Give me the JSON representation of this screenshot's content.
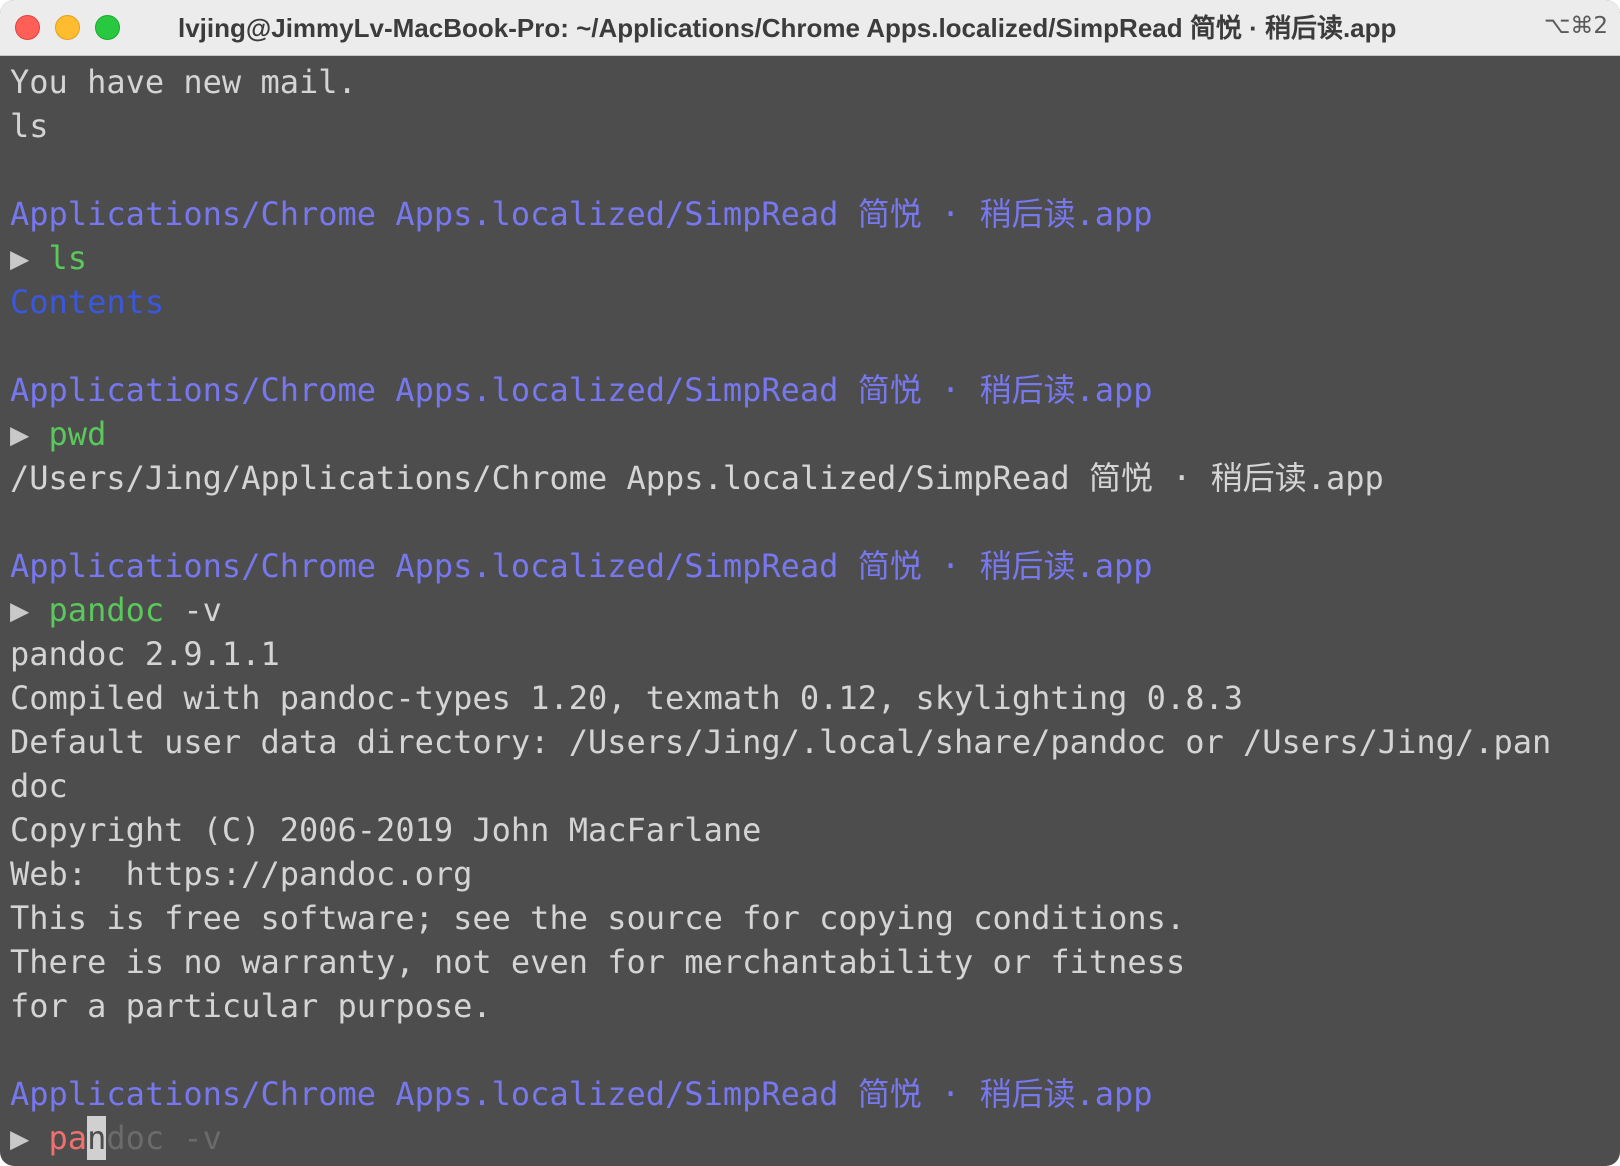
{
  "window": {
    "title": "lvjing@JimmyLv-MacBook-Pro: ~/Applications/Chrome Apps.localized/SimpRead 简悦 · 稍后读.app",
    "shortcut": "⌥⌘2"
  },
  "terminal": {
    "mail_notice": "You have new mail.",
    "typed_ls": "ls",
    "prompt_path": "Applications/Chrome Apps.localized/SimpRead 简悦 · 稍后读.app",
    "prompt_symbol": "▶",
    "cmd1": "ls",
    "out_contents": "Contents",
    "cmd2": "pwd",
    "out_pwd": "/Users/Jing/Applications/Chrome Apps.localized/SimpRead 简悦 · 稍后读.app",
    "cmd3_name": "pandoc",
    "cmd3_args": " -v",
    "pandoc_output": [
      "pandoc 2.9.1.1",
      "Compiled with pandoc-types 1.20, texmath 0.12, skylighting 0.8.3",
      "Default user data directory: /Users/Jing/.local/share/pandoc or /Users/Jing/.pan",
      "doc",
      "Copyright (C) 2006-2019 John MacFarlane",
      "Web:  https://pandoc.org",
      "This is free software; see the source for copying conditions.",
      "There is no warranty, not even for merchantability or fitness",
      "for a particular purpose."
    ],
    "current_input_typed": "pa",
    "current_input_cursor_char": "n",
    "current_input_suggestion": "doc -v"
  },
  "colors": {
    "background": "#4d4d4d",
    "path": "#7777ee",
    "command": "#5ac85a",
    "directory": "#3a57e0",
    "invalid_command": "#f07070",
    "autosuggestion": "#6b6b6b"
  }
}
